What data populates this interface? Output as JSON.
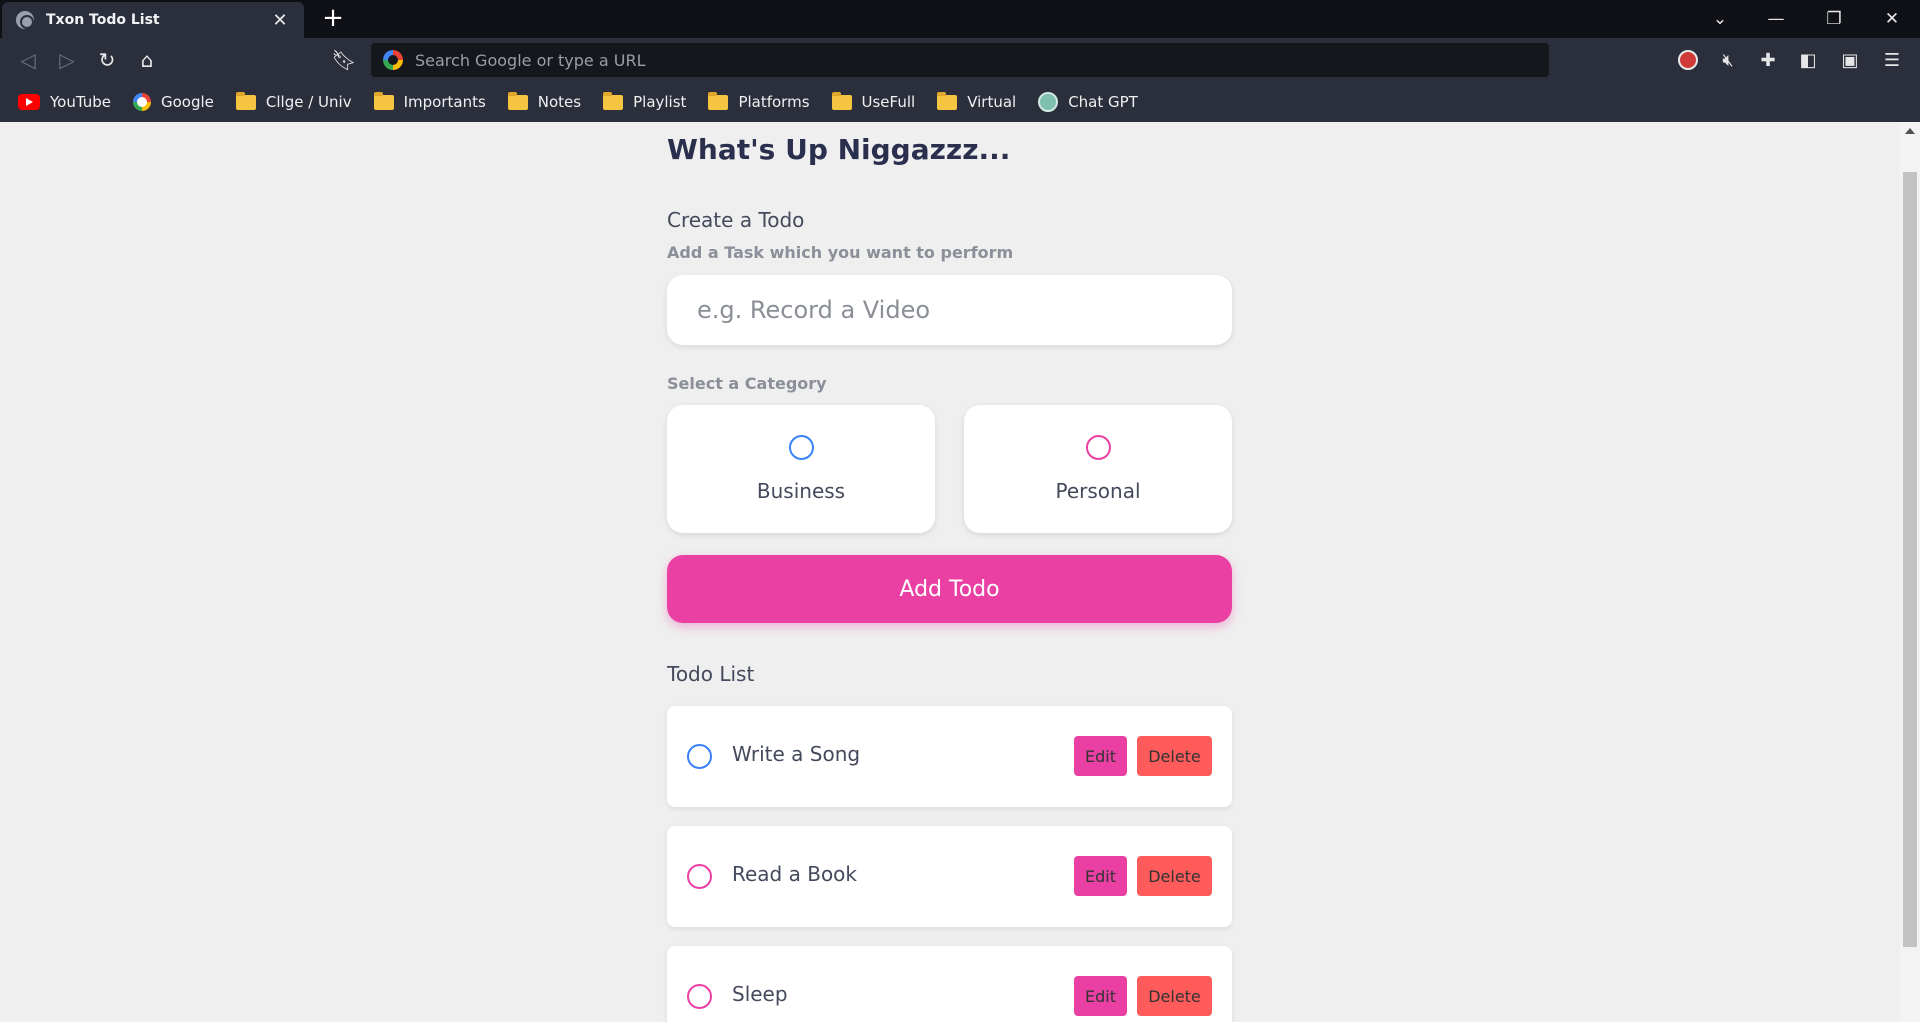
{
  "browser": {
    "tab_title": "Txon Todo List",
    "tab_close": "✕",
    "new_tab": "+",
    "omnibox_placeholder": "Search Google or type a URL",
    "bookmarks": [
      {
        "label": "YouTube",
        "icon": "youtube-icon"
      },
      {
        "label": "Google",
        "icon": "google-icon"
      },
      {
        "label": "Cllge / Univ",
        "icon": "folder-icon"
      },
      {
        "label": "Importants",
        "icon": "folder-icon"
      },
      {
        "label": "Notes",
        "icon": "folder-icon"
      },
      {
        "label": "Playlist",
        "icon": "folder-icon"
      },
      {
        "label": "Platforms",
        "icon": "folder-icon"
      },
      {
        "label": "UseFull",
        "icon": "folder-icon"
      },
      {
        "label": "Virtual",
        "icon": "folder-icon"
      },
      {
        "label": "Chat GPT",
        "icon": "chatgpt-icon"
      }
    ]
  },
  "page": {
    "title": "What's Up Niggazzz...",
    "create_heading": "Create a Todo",
    "task_label": "Add a Task which you want to perform",
    "task_placeholder": "e.g. Record a Video",
    "category_label": "Select a Category",
    "categories": [
      {
        "label": "Business",
        "color": "#3a82f7"
      },
      {
        "label": "Personal",
        "color": "#ea40a4"
      }
    ],
    "add_button": "Add Todo",
    "list_heading": "Todo List",
    "todos": [
      {
        "text": "Write a Song",
        "category_color": "#3a82f7",
        "edit": "Edit",
        "delete": "Delete"
      },
      {
        "text": "Read a Book",
        "category_color": "#ea40a4",
        "edit": "Edit",
        "delete": "Delete"
      },
      {
        "text": "Sleep",
        "category_color": "#ea40a4",
        "edit": "Edit",
        "delete": "Delete"
      }
    ]
  },
  "colors": {
    "accent_pink": "#ea40a4",
    "business_blue": "#3a82f7",
    "delete_red": "#ff5b5b",
    "page_bg": "#efefef",
    "heading": "#2b2f4e"
  }
}
